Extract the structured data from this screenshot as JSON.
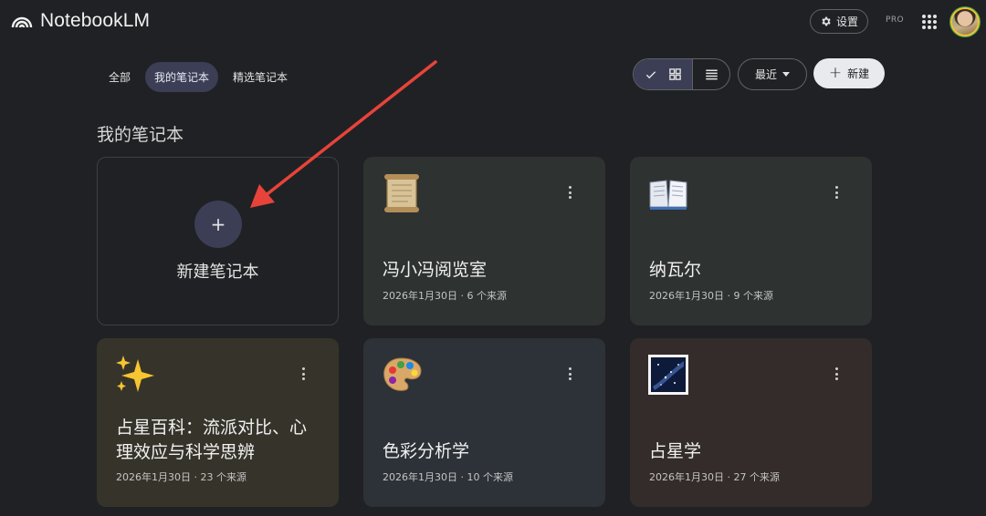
{
  "app": {
    "title": "NotebookLM"
  },
  "header": {
    "settings_label": "设置",
    "pro_label": "PRO"
  },
  "tabs": [
    {
      "label": "全部"
    },
    {
      "label": "我的笔记本"
    },
    {
      "label": "精选笔记本"
    }
  ],
  "toolbar": {
    "sort_label": "最近",
    "new_label": "新建"
  },
  "section": {
    "title": "我的笔记本"
  },
  "new_card": {
    "label": "新建笔记本"
  },
  "notebooks": [
    {
      "title": "冯小冯阅览室",
      "meta": "2026年1月30日 · 6 个来源",
      "icon": "scroll-icon",
      "color": "#2e3230"
    },
    {
      "title": "纳瓦尔",
      "meta": "2026年1月30日 · 9 个来源",
      "icon": "open-book-icon",
      "color": "#2e3230"
    },
    {
      "title": "占星百科：流派对比、心理效应与科学思辨",
      "meta": "2026年1月30日 · 23 个来源",
      "icon": "sparkles-icon",
      "color": "#36342a"
    },
    {
      "title": "色彩分析学",
      "meta": "2026年1月30日 · 10 个来源",
      "icon": "palette-icon",
      "color": "#2d3238"
    },
    {
      "title": "占星学",
      "meta": "2026年1月30日 · 27 个来源",
      "icon": "milky-way-icon",
      "color": "#332c2a"
    }
  ]
}
